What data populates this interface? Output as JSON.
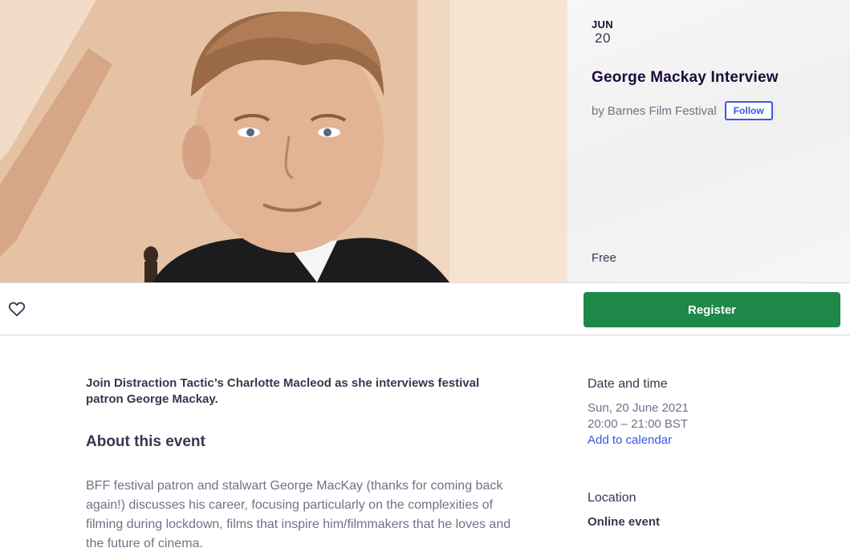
{
  "event": {
    "month": "JUN",
    "day": "20",
    "title": "George Mackay Interview",
    "organizer_prefix": "by",
    "organizer": "Barnes Film Festival",
    "follow_label": "Follow",
    "price": "Free"
  },
  "actions": {
    "like_icon": "heart-icon",
    "register_label": "Register"
  },
  "content": {
    "summary": "Join Distraction Tactic’s Charlotte Macleod as she interviews festival patron George Mackay.",
    "about_heading": "About this event",
    "description": "BFF festival patron and stalwart George MacKay (thanks for coming back again!) discusses his career, focusing particularly on the complexities of filming during lockdown, films that inspire him/filmmakers that he loves and the future of cinema."
  },
  "date_time": {
    "heading": "Date and time",
    "date": "Sun, 20 June 2021",
    "time": "20:00 – 21:00 BST",
    "calendar_link": "Add to calendar"
  },
  "location": {
    "heading": "Location",
    "value": "Online event"
  },
  "colors": {
    "brand_green": "#1e8848",
    "link_blue": "#3659e3",
    "title_dark": "#1e0a3c"
  }
}
